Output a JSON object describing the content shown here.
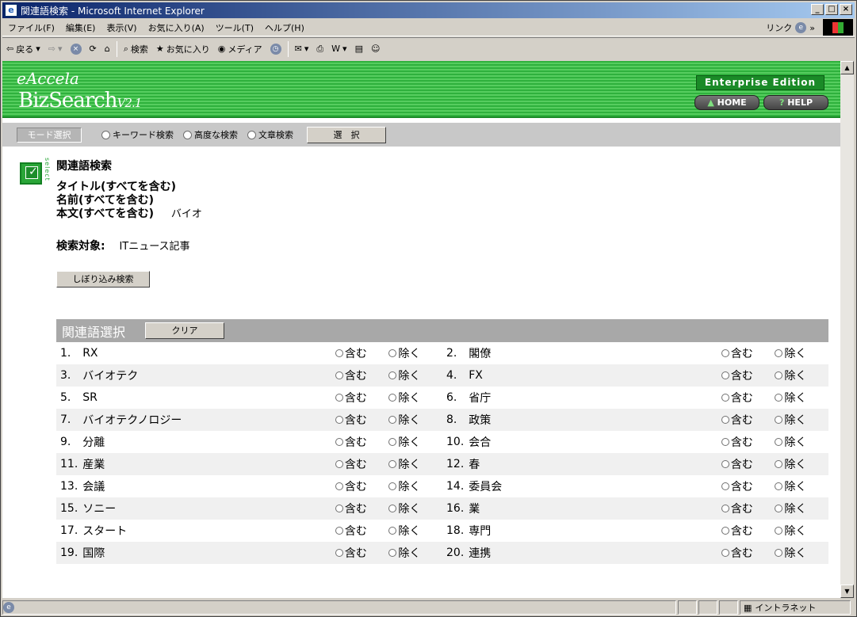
{
  "window": {
    "title": "関連語検索 - Microsoft Internet Explorer",
    "min": "_",
    "max": "□",
    "close": "×"
  },
  "menu": {
    "items": [
      "ファイル(F)",
      "編集(E)",
      "表示(V)",
      "お気に入り(A)",
      "ツール(T)",
      "ヘルプ(H)"
    ],
    "links_label": "リンク",
    "more": "»"
  },
  "toolbar": {
    "back": "戻る",
    "search": "検索",
    "favorites": "お気に入り",
    "media": "メディア"
  },
  "banner": {
    "logo_top": "eAccela",
    "logo_main": "BizSearch",
    "logo_version": "V2.1",
    "edition": "Enterprise Edition",
    "home": "HOME",
    "help": "HELP"
  },
  "mode": {
    "label": "モード選択",
    "options": [
      "キーワード検索",
      "高度な検索",
      "文章検索"
    ],
    "select_button": "選　択"
  },
  "search": {
    "icon_text": "select",
    "heading": "関連語検索",
    "criteria": [
      {
        "label": "タイトル(すべてを含む)",
        "value": ""
      },
      {
        "label": "名前(すべてを含む)",
        "value": ""
      },
      {
        "label": "本文(すべてを含む)",
        "value": "バイオ"
      }
    ],
    "target_label": "検索対象:",
    "target_value": "ITニュース記事",
    "refine_button": "しぼり込み検索"
  },
  "related": {
    "heading": "関連語選択",
    "clear_button": "クリア",
    "include_label": "含む",
    "exclude_label": "除く",
    "terms": [
      {
        "num": "1.",
        "term": "RX"
      },
      {
        "num": "2.",
        "term": "閣僚"
      },
      {
        "num": "3.",
        "term": "バイオテク"
      },
      {
        "num": "4.",
        "term": "FX"
      },
      {
        "num": "5.",
        "term": "SR"
      },
      {
        "num": "6.",
        "term": "省庁"
      },
      {
        "num": "7.",
        "term": "バイオテクノロジー"
      },
      {
        "num": "8.",
        "term": "政策"
      },
      {
        "num": "9.",
        "term": "分離"
      },
      {
        "num": "10.",
        "term": "会合"
      },
      {
        "num": "11.",
        "term": "産業"
      },
      {
        "num": "12.",
        "term": "春"
      },
      {
        "num": "13.",
        "term": "会議"
      },
      {
        "num": "14.",
        "term": "委員会"
      },
      {
        "num": "15.",
        "term": "ソニー"
      },
      {
        "num": "16.",
        "term": "業"
      },
      {
        "num": "17.",
        "term": "スタート"
      },
      {
        "num": "18.",
        "term": "専門"
      },
      {
        "num": "19.",
        "term": "国際"
      },
      {
        "num": "20.",
        "term": "連携"
      }
    ]
  },
  "status": {
    "zone": "イントラネット"
  }
}
